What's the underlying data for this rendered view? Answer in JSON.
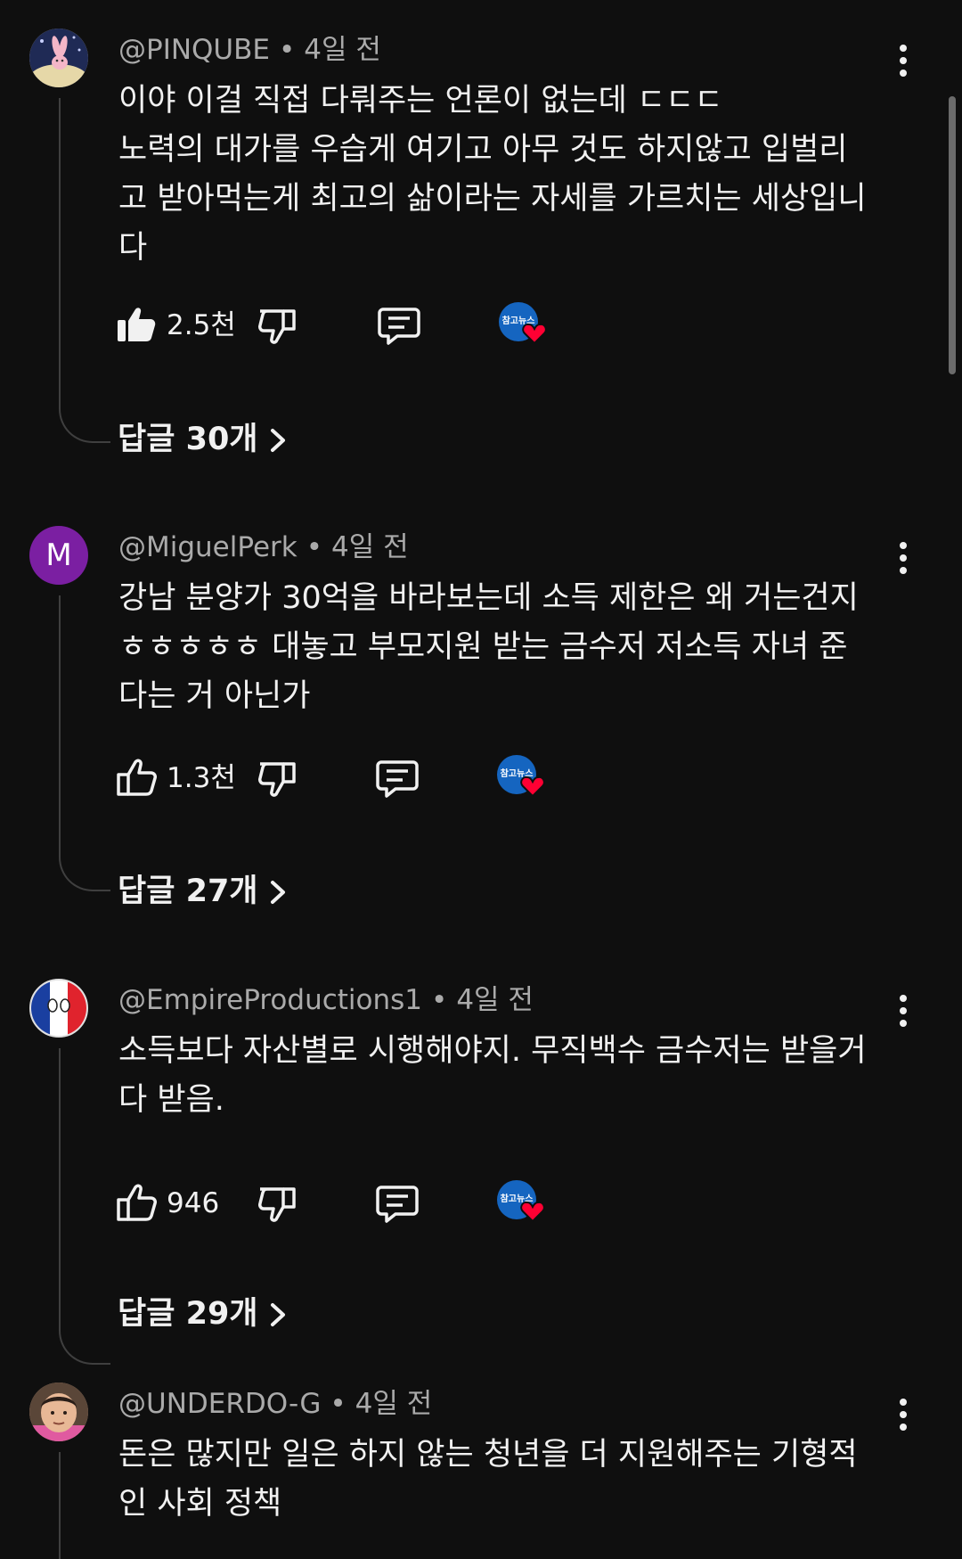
{
  "comments": [
    {
      "author": "@PINQUBE",
      "time": "4일 전",
      "text_lines": [
        "이야 이걸 직접 다뤄주는 언론이 없는데 ㄷㄷㄷ",
        "노력의 대가를 우습게 여기고 아무 것도 하지않고 입벌리",
        "고 받아먹는게 최고의 삶이라는 자세를 가르치는 세상입니",
        "다"
      ],
      "likes": "2.5천",
      "liked": true,
      "replies_label": "답글 30개",
      "avatar_icon": "rabbit-avatar-icon"
    },
    {
      "author": "@MiguelPerk",
      "time": "4일 전",
      "text_lines": [
        "강남 분양가 30억을 바라보는데 소득 제한은 왜 거는건지",
        "ㅎㅎㅎㅎㅎ 대놓고 부모지원 받는 금수저 저소득 자녀 준",
        "다는 거 아닌가"
      ],
      "likes": "1.3천",
      "liked": false,
      "replies_label": "답글 27개",
      "avatar_letter": "M",
      "avatar_color": "#7b1fa2"
    },
    {
      "author": "@EmpireProductions1",
      "time": "4일 전",
      "text_lines": [
        "소득보다 자산별로 시행해야지. 무직백수 금수저는 받을거",
        "다 받음."
      ],
      "likes": "946",
      "liked": false,
      "replies_label": "답글 29개",
      "avatar_icon": "france-ball-avatar-icon"
    },
    {
      "author": "@UNDERDO-G",
      "time": "4일 전",
      "text_lines": [
        "돈은 많지만 일은 하지 않는 청년을 더 지원해주는 기형적",
        "인 사회 정책"
      ],
      "avatar_icon": "person-photo-avatar-icon"
    }
  ],
  "creator_badge_text": "참고뉴스",
  "separator": "•",
  "colors": {
    "background": "#0f0f0f",
    "text_primary": "#f1f1f1",
    "text_secondary": "#aaaaaa",
    "heart_red": "#ff0033",
    "creator_blue": "#1565c0"
  }
}
